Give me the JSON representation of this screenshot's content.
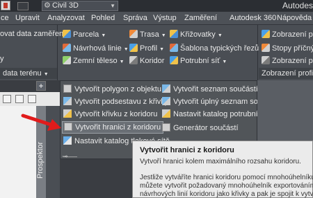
{
  "titlebar": {
    "workspace": "Civil 3D",
    "app_title": "Autodes"
  },
  "menubar": {
    "tabs": [
      "ce",
      "Upravit",
      "Analyzovat",
      "Pohled",
      "Správa",
      "Výstup",
      "Zaměření",
      "Autodesk 360",
      "Nápověda"
    ]
  },
  "ribbon": {
    "col1": {
      "line1": "ovat data zaměření",
      "line2": "y"
    },
    "col2": {
      "parcela": "Parcela",
      "navrhova_linie": "Návrhová linie",
      "zemni_teleso": "Zemní těleso"
    },
    "col3": {
      "trasa": "Trasa",
      "profil": "Profil",
      "koridor": "Koridor"
    },
    "col4": {
      "krizovatky": "Křižovatky",
      "sablona": "Šablona typických řezů",
      "potrubni_sit": "Potrubní síť"
    },
    "col5": {
      "zobrazeni1": "Zobrazení p",
      "stopy": "Stopy příčný",
      "zobrazeni2": "Zobrazení p"
    },
    "panel_left": "data terénu",
    "panel_right": "Zobrazení profilu a"
  },
  "dropdown": {
    "left": [
      "Vytvořit polygon z objektu",
      "Vytvořit podsestavu z křivky",
      "Vytvořit křivku z koridoru",
      "Vytvořit hranici z koridoru",
      "Nastavit katalog tlakové sítě"
    ],
    "right": [
      "Vytvořit seznam součástí sítě",
      "Vytvořit úplný seznam součástí",
      "Nastavit katalog potrubní sítě",
      "Generátor součástí"
    ]
  },
  "tooltip": {
    "title": "Vytvořit hranici z koridoru",
    "line1": "Vytvoří hranici kolem maximálního rozsahu koridoru.",
    "line2": "Jestliže vytváříte hranici koridoru pomocí mnohoúhelníku,",
    "line3": "můžete vytvořit požadovaný mnohoúhelník exportováním",
    "line4": "návrhových linií koridoru jako křivky a pak je spojit k vytvoř"
  },
  "left_pane": {
    "prospektor": "Prospektor",
    "plus": "+"
  }
}
